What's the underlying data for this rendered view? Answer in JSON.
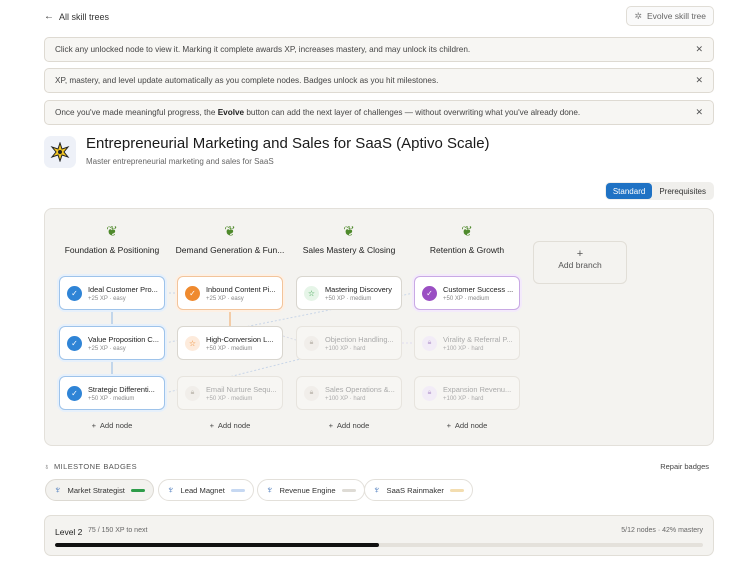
{
  "header": {
    "back_label": "All skill trees",
    "evolve_label": "Evolve skill tree"
  },
  "banners": [
    {
      "text": "Click any unlocked node to view it. Marking it complete awards XP, increases mastery, and may unlock its children."
    },
    {
      "text": "XP, mastery, and level update automatically as you complete nodes. Badges unlock as you hit milestones."
    },
    {
      "text_before": "Once you've made meaningful progress, the ",
      "text_bold": "Evolve",
      "text_after": " button can add the next layer of challenges — without overwriting what you've already done."
    }
  ],
  "tree": {
    "icon": "sparkle-badge-icon",
    "title": "Entrepreneurial Marketing and Sales for SaaS (Aptivo Scale)",
    "subtitle": "Master entrepreneurial marketing and sales for SaaS"
  },
  "view_toggle": {
    "standard": "Standard",
    "prerequisites": "Prerequisites",
    "active": "standard"
  },
  "branches": [
    {
      "name": "Foundation & Positioning",
      "nodes": [
        {
          "title": "Ideal Customer Pro...",
          "meta": "+25 XP · easy",
          "state": "completed"
        },
        {
          "title": "Value Proposition C...",
          "meta": "+25 XP · easy",
          "state": "completed"
        },
        {
          "title": "Strategic Differenti...",
          "meta": "+50 XP · medium",
          "state": "completed"
        }
      ],
      "add_label": "Add node"
    },
    {
      "name": "Demand Generation & Fun...",
      "nodes": [
        {
          "title": "Inbound Content Pi...",
          "meta": "+25 XP · easy",
          "state": "completed"
        },
        {
          "title": "High-Conversion L...",
          "meta": "+50 XP · medium",
          "state": "unlocked"
        },
        {
          "title": "Email Nurture Sequ...",
          "meta": "+50 XP · medium",
          "state": "locked"
        }
      ],
      "add_label": "Add node"
    },
    {
      "name": "Sales Mastery & Closing",
      "nodes": [
        {
          "title": "Mastering Discovery",
          "meta": "+50 XP · medium",
          "state": "unlocked"
        },
        {
          "title": "Objection Handling...",
          "meta": "+100 XP · hard",
          "state": "locked"
        },
        {
          "title": "Sales Operations &...",
          "meta": "+100 XP · hard",
          "state": "locked"
        }
      ],
      "add_label": "Add node"
    },
    {
      "name": "Retention & Growth",
      "nodes": [
        {
          "title": "Customer Success ...",
          "meta": "+50 XP · medium",
          "state": "completed"
        },
        {
          "title": "Virality & Referral P...",
          "meta": "+100 XP · hard",
          "state": "locked"
        },
        {
          "title": "Expansion Revenu...",
          "meta": "+100 XP · hard",
          "state": "locked"
        }
      ],
      "add_label": "Add node"
    }
  ],
  "add_branch_label": "Add branch",
  "milestones": {
    "heading": "MILESTONE BADGES",
    "repair_label": "Repair badges",
    "badges": [
      {
        "name": "Market Strategist",
        "earned": true,
        "color": "#2e9c4a"
      },
      {
        "name": "Lead Magnet",
        "earned": false,
        "color": "#c6d8f2"
      },
      {
        "name": "Revenue Engine",
        "earned": false,
        "color": "#dedbd5"
      },
      {
        "name": "SaaS Rainmaker",
        "earned": false,
        "color": "#f3ddb0"
      }
    ]
  },
  "level": {
    "title": "Level 2",
    "xp_text": "75 / 150 XP to next",
    "stats_text": "5/12 nodes · 42% mastery",
    "progress_fraction": 0.5
  },
  "colors": {
    "accent_blue": "#1f72c4",
    "complete_blue": "#2f84d6",
    "complete_orange": "#ef8a2f",
    "complete_purple": "#9a4fc3",
    "leaf_green": "#4f8a2c"
  }
}
